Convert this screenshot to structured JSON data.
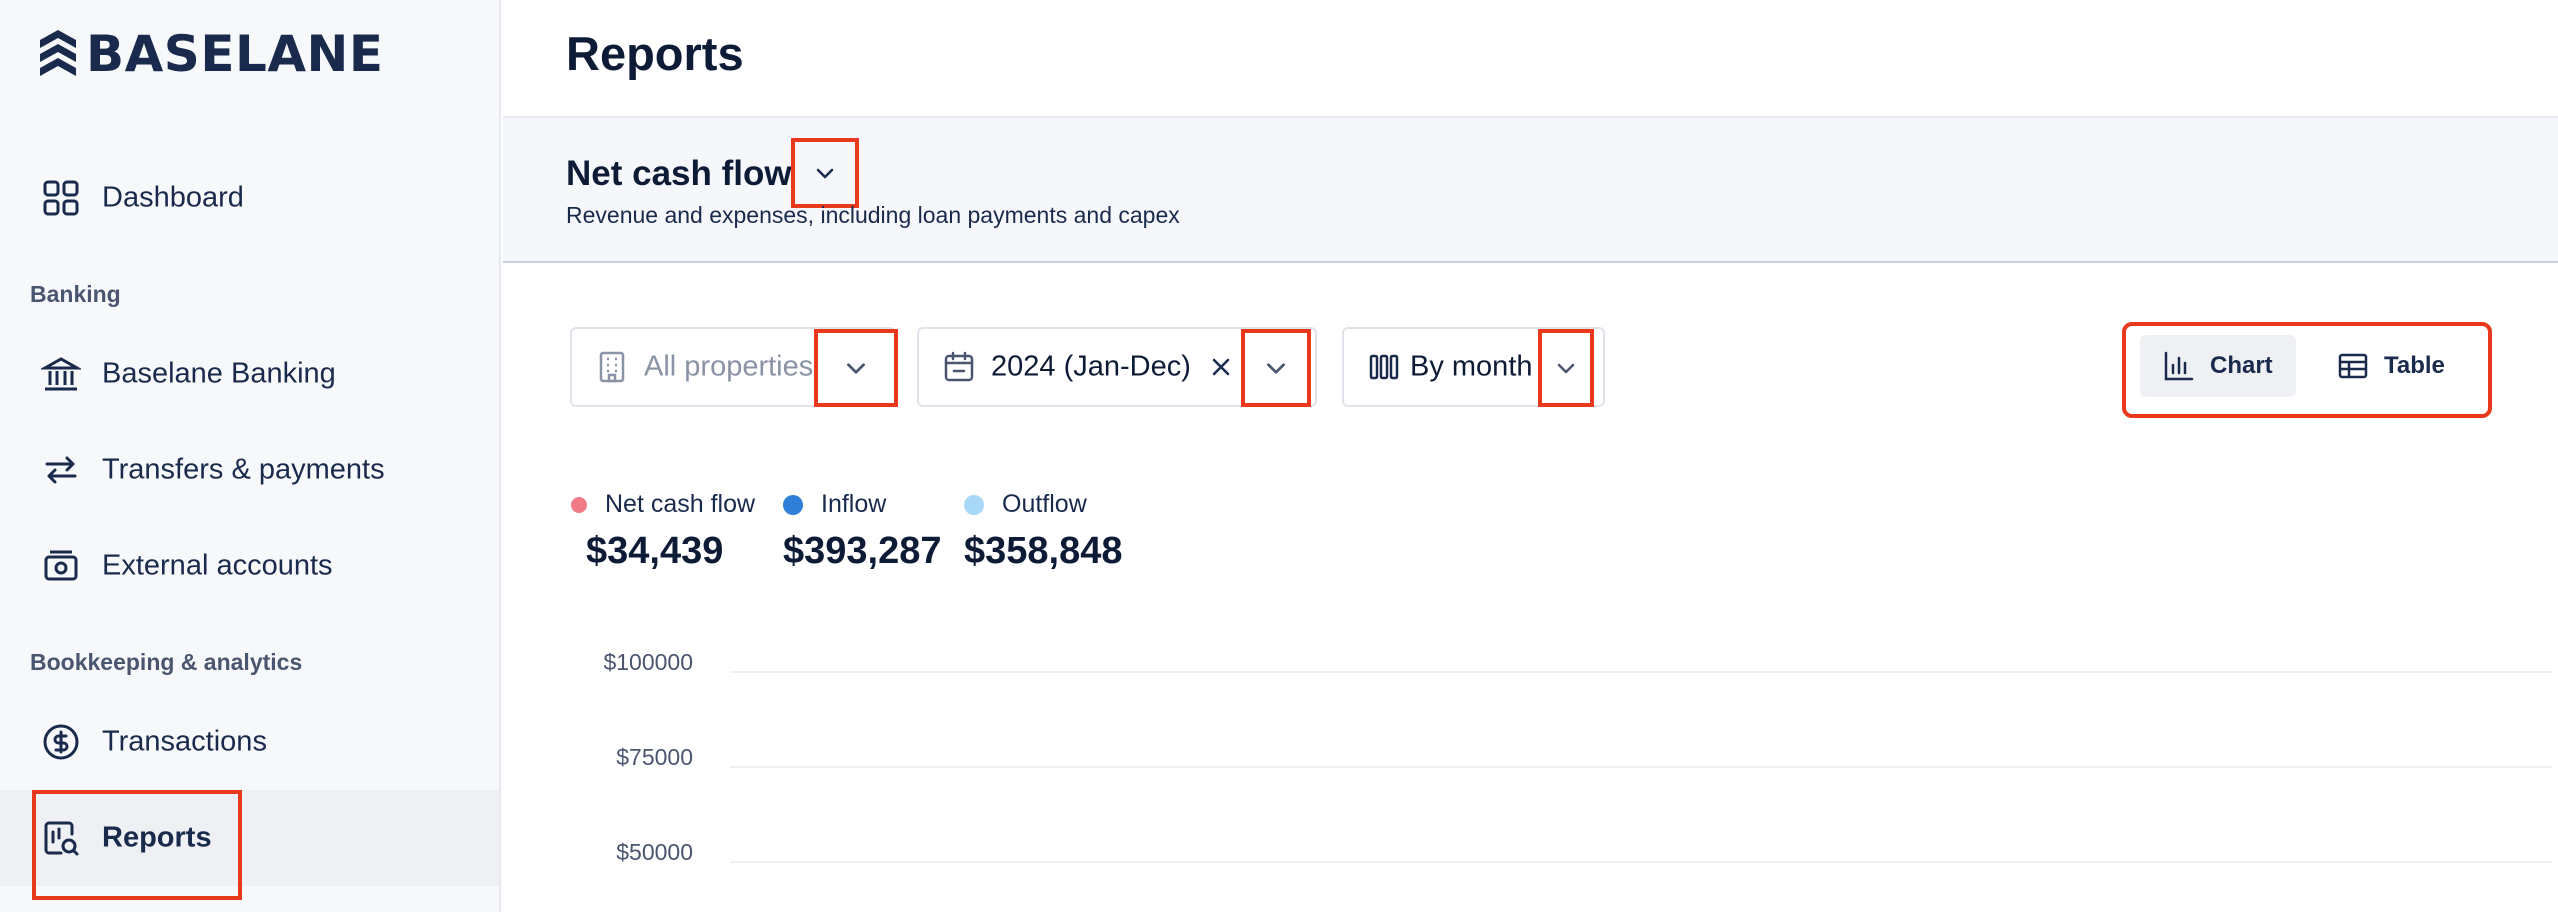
{
  "brand": {
    "name": "BASELANE"
  },
  "sidebar": {
    "dashboard": "Dashboard",
    "section_banking": "Banking",
    "banking": "Baselane Banking",
    "transfers": "Transfers & payments",
    "external": "External accounts",
    "section_bookkeeping": "Bookkeeping & analytics",
    "transactions": "Transactions",
    "reports": "Reports"
  },
  "header": {
    "title": "Reports"
  },
  "report": {
    "title": "Net cash flow",
    "subtitle": "Revenue and expenses, including loan payments and capex"
  },
  "filters": {
    "properties_placeholder": "All properties",
    "date_range": "2024 (Jan-Dec)",
    "grouping": "By month"
  },
  "view_toggle": {
    "chart": "Chart",
    "table": "Table",
    "selected": "Chart"
  },
  "summary": {
    "net_label": "Net cash flow",
    "net_value": "$34,439",
    "inflow_label": "Inflow",
    "inflow_value": "$393,287",
    "outflow_label": "Outflow",
    "outflow_value": "$358,848"
  },
  "colors": {
    "net": "#f07a85",
    "inflow": "#2e7fd6",
    "outflow": "#a7d8f7",
    "highlight": "#e8391d"
  },
  "chart_data": {
    "type": "bar",
    "title": "",
    "xlabel": "",
    "ylabel": "",
    "ylim": [
      50000,
      100000
    ],
    "y_ticks": [
      "$100000",
      "$75000",
      "$50000"
    ],
    "series": [],
    "categories": [],
    "grid": true
  }
}
